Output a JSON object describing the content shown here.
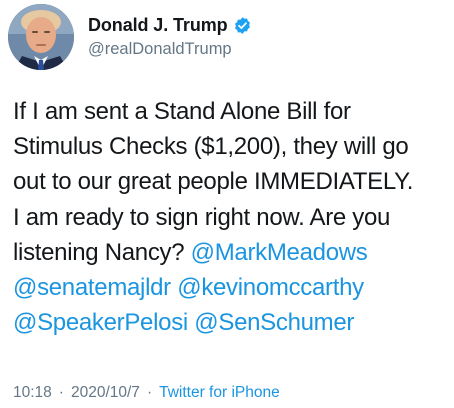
{
  "author": {
    "display_name": "Donald J. Trump",
    "handle": "@realDonaldTrump",
    "verified": true,
    "avatar_icon": "profile-photo",
    "verified_icon": "verified-badge-icon"
  },
  "tweet": {
    "lines": [
      {
        "text": "If I am sent a Stand Alone Bill for"
      },
      {
        "text": "Stimulus Checks ($1,200), they will go"
      },
      {
        "text": "out to our great people IMMEDIATELY."
      },
      {
        "text": "I am ready to sign right now. Are you"
      },
      {
        "text": "listening Nancy? ",
        "mention": "@MarkMeadows"
      }
    ],
    "mention_lines": [
      [
        "@senatemajldr",
        "@kevinomccarthy"
      ],
      [
        "@SpeakerPelosi",
        "@SenSchumer"
      ]
    ]
  },
  "meta": {
    "time": "10:18",
    "separator": "·",
    "date": "2020/10/7",
    "source": "Twitter for iPhone"
  },
  "colors": {
    "link": "#1b95e0",
    "text": "#14171a",
    "secondary": "#657786",
    "verified": "#1da1f2"
  }
}
